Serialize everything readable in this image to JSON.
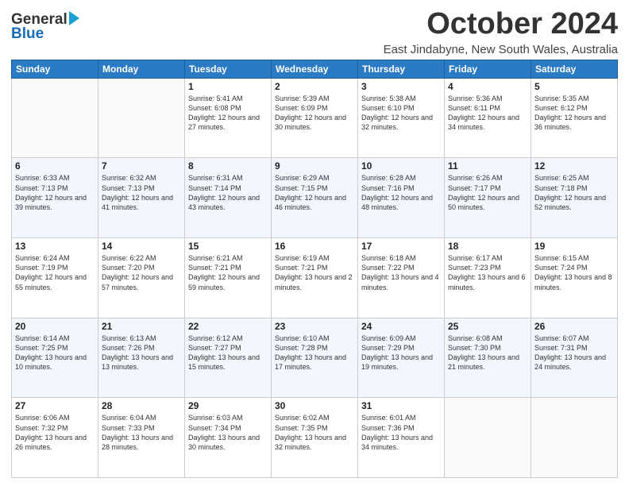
{
  "logo": {
    "general": "General",
    "blue": "Blue"
  },
  "header": {
    "month": "October 2024",
    "location": "East Jindabyne, New South Wales, Australia"
  },
  "days_of_week": [
    "Sunday",
    "Monday",
    "Tuesday",
    "Wednesday",
    "Thursday",
    "Friday",
    "Saturday"
  ],
  "weeks": [
    [
      {
        "day": "",
        "sunrise": "",
        "sunset": "",
        "daylight": ""
      },
      {
        "day": "",
        "sunrise": "",
        "sunset": "",
        "daylight": ""
      },
      {
        "day": "1",
        "sunrise": "Sunrise: 5:41 AM",
        "sunset": "Sunset: 6:08 PM",
        "daylight": "Daylight: 12 hours and 27 minutes."
      },
      {
        "day": "2",
        "sunrise": "Sunrise: 5:39 AM",
        "sunset": "Sunset: 6:09 PM",
        "daylight": "Daylight: 12 hours and 30 minutes."
      },
      {
        "day": "3",
        "sunrise": "Sunrise: 5:38 AM",
        "sunset": "Sunset: 6:10 PM",
        "daylight": "Daylight: 12 hours and 32 minutes."
      },
      {
        "day": "4",
        "sunrise": "Sunrise: 5:36 AM",
        "sunset": "Sunset: 6:11 PM",
        "daylight": "Daylight: 12 hours and 34 minutes."
      },
      {
        "day": "5",
        "sunrise": "Sunrise: 5:35 AM",
        "sunset": "Sunset: 6:12 PM",
        "daylight": "Daylight: 12 hours and 36 minutes."
      }
    ],
    [
      {
        "day": "6",
        "sunrise": "Sunrise: 6:33 AM",
        "sunset": "Sunset: 7:13 PM",
        "daylight": "Daylight: 12 hours and 39 minutes."
      },
      {
        "day": "7",
        "sunrise": "Sunrise: 6:32 AM",
        "sunset": "Sunset: 7:13 PM",
        "daylight": "Daylight: 12 hours and 41 minutes."
      },
      {
        "day": "8",
        "sunrise": "Sunrise: 6:31 AM",
        "sunset": "Sunset: 7:14 PM",
        "daylight": "Daylight: 12 hours and 43 minutes."
      },
      {
        "day": "9",
        "sunrise": "Sunrise: 6:29 AM",
        "sunset": "Sunset: 7:15 PM",
        "daylight": "Daylight: 12 hours and 46 minutes."
      },
      {
        "day": "10",
        "sunrise": "Sunrise: 6:28 AM",
        "sunset": "Sunset: 7:16 PM",
        "daylight": "Daylight: 12 hours and 48 minutes."
      },
      {
        "day": "11",
        "sunrise": "Sunrise: 6:26 AM",
        "sunset": "Sunset: 7:17 PM",
        "daylight": "Daylight: 12 hours and 50 minutes."
      },
      {
        "day": "12",
        "sunrise": "Sunrise: 6:25 AM",
        "sunset": "Sunset: 7:18 PM",
        "daylight": "Daylight: 12 hours and 52 minutes."
      }
    ],
    [
      {
        "day": "13",
        "sunrise": "Sunrise: 6:24 AM",
        "sunset": "Sunset: 7:19 PM",
        "daylight": "Daylight: 12 hours and 55 minutes."
      },
      {
        "day": "14",
        "sunrise": "Sunrise: 6:22 AM",
        "sunset": "Sunset: 7:20 PM",
        "daylight": "Daylight: 12 hours and 57 minutes."
      },
      {
        "day": "15",
        "sunrise": "Sunrise: 6:21 AM",
        "sunset": "Sunset: 7:21 PM",
        "daylight": "Daylight: 12 hours and 59 minutes."
      },
      {
        "day": "16",
        "sunrise": "Sunrise: 6:19 AM",
        "sunset": "Sunset: 7:21 PM",
        "daylight": "Daylight: 13 hours and 2 minutes."
      },
      {
        "day": "17",
        "sunrise": "Sunrise: 6:18 AM",
        "sunset": "Sunset: 7:22 PM",
        "daylight": "Daylight: 13 hours and 4 minutes."
      },
      {
        "day": "18",
        "sunrise": "Sunrise: 6:17 AM",
        "sunset": "Sunset: 7:23 PM",
        "daylight": "Daylight: 13 hours and 6 minutes."
      },
      {
        "day": "19",
        "sunrise": "Sunrise: 6:15 AM",
        "sunset": "Sunset: 7:24 PM",
        "daylight": "Daylight: 13 hours and 8 minutes."
      }
    ],
    [
      {
        "day": "20",
        "sunrise": "Sunrise: 6:14 AM",
        "sunset": "Sunset: 7:25 PM",
        "daylight": "Daylight: 13 hours and 10 minutes."
      },
      {
        "day": "21",
        "sunrise": "Sunrise: 6:13 AM",
        "sunset": "Sunset: 7:26 PM",
        "daylight": "Daylight: 13 hours and 13 minutes."
      },
      {
        "day": "22",
        "sunrise": "Sunrise: 6:12 AM",
        "sunset": "Sunset: 7:27 PM",
        "daylight": "Daylight: 13 hours and 15 minutes."
      },
      {
        "day": "23",
        "sunrise": "Sunrise: 6:10 AM",
        "sunset": "Sunset: 7:28 PM",
        "daylight": "Daylight: 13 hours and 17 minutes."
      },
      {
        "day": "24",
        "sunrise": "Sunrise: 6:09 AM",
        "sunset": "Sunset: 7:29 PM",
        "daylight": "Daylight: 13 hours and 19 minutes."
      },
      {
        "day": "25",
        "sunrise": "Sunrise: 6:08 AM",
        "sunset": "Sunset: 7:30 PM",
        "daylight": "Daylight: 13 hours and 21 minutes."
      },
      {
        "day": "26",
        "sunrise": "Sunrise: 6:07 AM",
        "sunset": "Sunset: 7:31 PM",
        "daylight": "Daylight: 13 hours and 24 minutes."
      }
    ],
    [
      {
        "day": "27",
        "sunrise": "Sunrise: 6:06 AM",
        "sunset": "Sunset: 7:32 PM",
        "daylight": "Daylight: 13 hours and 26 minutes."
      },
      {
        "day": "28",
        "sunrise": "Sunrise: 6:04 AM",
        "sunset": "Sunset: 7:33 PM",
        "daylight": "Daylight: 13 hours and 28 minutes."
      },
      {
        "day": "29",
        "sunrise": "Sunrise: 6:03 AM",
        "sunset": "Sunset: 7:34 PM",
        "daylight": "Daylight: 13 hours and 30 minutes."
      },
      {
        "day": "30",
        "sunrise": "Sunrise: 6:02 AM",
        "sunset": "Sunset: 7:35 PM",
        "daylight": "Daylight: 13 hours and 32 minutes."
      },
      {
        "day": "31",
        "sunrise": "Sunrise: 6:01 AM",
        "sunset": "Sunset: 7:36 PM",
        "daylight": "Daylight: 13 hours and 34 minutes."
      },
      {
        "day": "",
        "sunrise": "",
        "sunset": "",
        "daylight": ""
      },
      {
        "day": "",
        "sunrise": "",
        "sunset": "",
        "daylight": ""
      }
    ]
  ]
}
